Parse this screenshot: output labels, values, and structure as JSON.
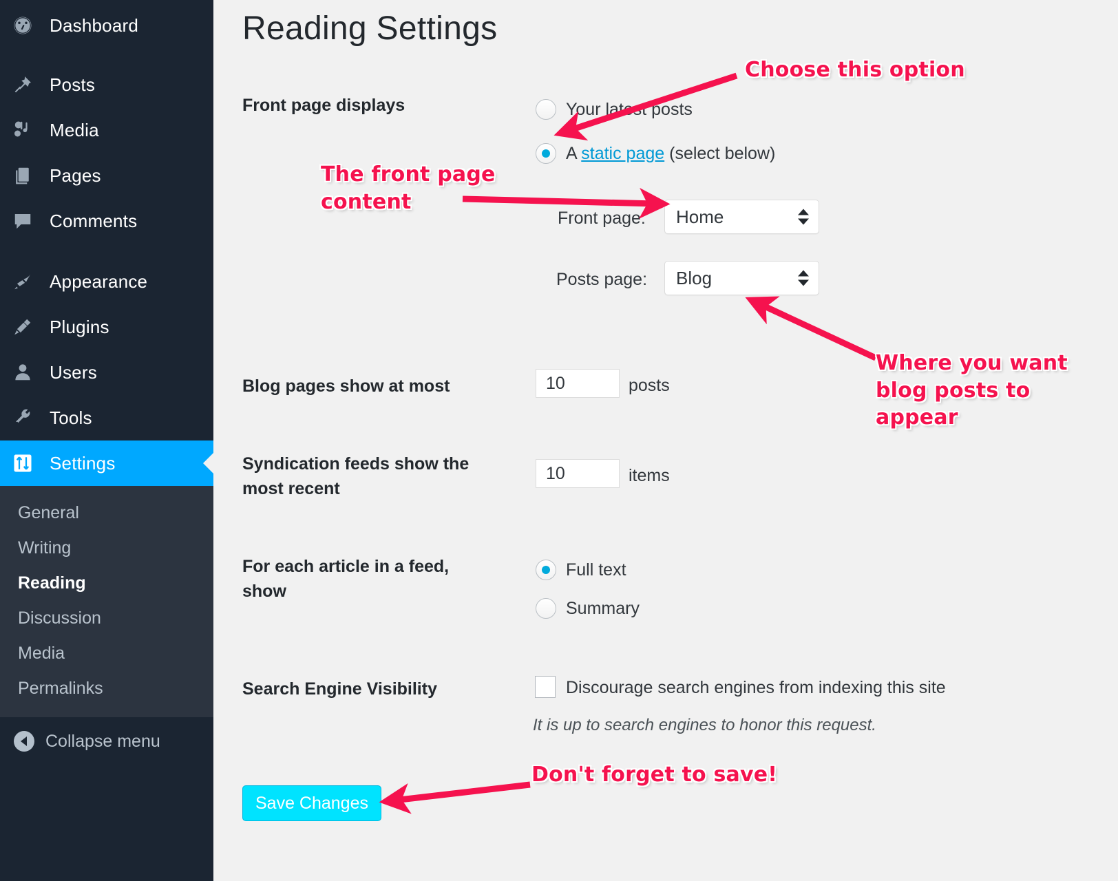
{
  "sidebar": {
    "items": [
      {
        "label": "Dashboard",
        "icon": "dashboard-icon"
      },
      {
        "label": "Posts",
        "icon": "pin-icon"
      },
      {
        "label": "Media",
        "icon": "media-icon"
      },
      {
        "label": "Pages",
        "icon": "pages-icon"
      },
      {
        "label": "Comments",
        "icon": "comment-icon"
      },
      {
        "label": "Appearance",
        "icon": "paintbrush-icon"
      },
      {
        "label": "Plugins",
        "icon": "plug-icon"
      },
      {
        "label": "Users",
        "icon": "user-icon"
      },
      {
        "label": "Tools",
        "icon": "wrench-icon"
      },
      {
        "label": "Settings",
        "icon": "settings-sliders-icon"
      }
    ],
    "submenu": [
      {
        "label": "General"
      },
      {
        "label": "Writing"
      },
      {
        "label": "Reading"
      },
      {
        "label": "Discussion"
      },
      {
        "label": "Media"
      },
      {
        "label": "Permalinks"
      }
    ],
    "current_item": "Settings",
    "current_subitem": "Reading",
    "collapse_label": "Collapse menu",
    "highlight_color": "#00a8ff",
    "background_color": "#1b2532",
    "submenu_background_color": "#2c3440"
  },
  "page": {
    "title": "Reading Settings"
  },
  "form": {
    "front_page_displays": {
      "label": "Front page displays",
      "options": [
        {
          "label": "Your latest posts",
          "selected": false
        },
        {
          "label_prefix": "A ",
          "link_text": "static page",
          "label_suffix": " (select below)",
          "selected": true
        }
      ],
      "front_page": {
        "label": "Front page:",
        "value": "Home"
      },
      "posts_page": {
        "label": "Posts page:",
        "value": "Blog"
      }
    },
    "blog_pages": {
      "label": "Blog pages show at most",
      "value": "10",
      "unit": "posts"
    },
    "syndication_feeds": {
      "label": "Syndication feeds show the most recent",
      "value": "10",
      "unit": "items"
    },
    "feed_article": {
      "label": "For each article in a feed, show",
      "options": [
        {
          "label": "Full text",
          "selected": true
        },
        {
          "label": "Summary",
          "selected": false
        }
      ]
    },
    "search_engine_visibility": {
      "label": "Search Engine Visibility",
      "checkbox_label": "Discourage search engines from indexing this site",
      "checked": false,
      "hint": "It is up to search engines to honor this request."
    },
    "save_label": "Save Changes",
    "save_color": "#00e3ff"
  },
  "annotations": {
    "color": "#f5124e",
    "items": [
      {
        "text": "Choose this option"
      },
      {
        "text": "The front page content"
      },
      {
        "text": "Where you want blog posts to appear"
      },
      {
        "text": "Don't forget to save!"
      }
    ],
    "choose_option": "Choose this option",
    "front_page_content_line1": "The front page",
    "front_page_content_line2": "content",
    "blog_posts_line1": "Where you want",
    "blog_posts_line2": "blog posts to",
    "blog_posts_line3": "appear",
    "save_reminder": "Don't forget to save!"
  }
}
